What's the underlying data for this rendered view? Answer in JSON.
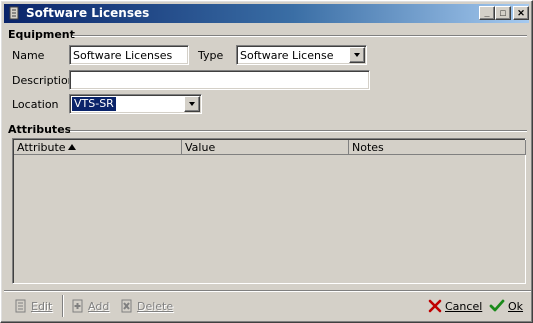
{
  "window": {
    "title": "Software Licenses",
    "title_icon": "window-list-icon",
    "controls": {
      "minimize": "_",
      "maximize": "□",
      "close": "✕"
    }
  },
  "equipment": {
    "section_label": "Equipment",
    "name_label": "Name",
    "name_value": "Software Licenses",
    "type_label": "Type",
    "type_value": "Software License",
    "description_label": "Description",
    "description_value": "",
    "location_label": "Location",
    "location_value": "VTS-SR"
  },
  "attributes": {
    "section_label": "Attributes",
    "columns": [
      "Attribute",
      "Value",
      "Notes"
    ],
    "sort_column": "Attribute",
    "sort_direction": "ascending",
    "rows": []
  },
  "toolbar": {
    "edit_label": "Edit",
    "add_label": "Add",
    "delete_label": "Delete",
    "cancel_label": "Cancel",
    "ok_label": "Ok"
  },
  "colors": {
    "face": "#d4d0c8",
    "title_start": "#0a246a",
    "title_end": "#a6caf0",
    "selection": "#0a246a",
    "cancel_red": "#c00000",
    "ok_green": "#1a8a1a"
  }
}
